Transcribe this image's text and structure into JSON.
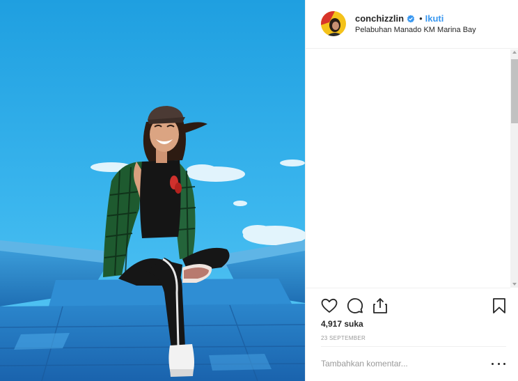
{
  "post": {
    "username": "conchizzlin",
    "dot_separator": "•",
    "follow_label": "Ikuti",
    "location": "Pelabuhan Manado KM Marina Bay",
    "likes_label": "4,917 suka",
    "date_label": "23 SEPTEMBER",
    "comment_placeholder": "Tambahkan komentar..."
  },
  "icons": {
    "verified": "verified-badge-icon",
    "like": "heart-icon",
    "comment": "comment-bubble-icon",
    "share": "share-icon",
    "save": "bookmark-icon",
    "more": "more-options-icon"
  },
  "colors": {
    "link_blue": "#3897f0",
    "text": "#262626",
    "muted": "#999999",
    "border": "#efefef"
  }
}
